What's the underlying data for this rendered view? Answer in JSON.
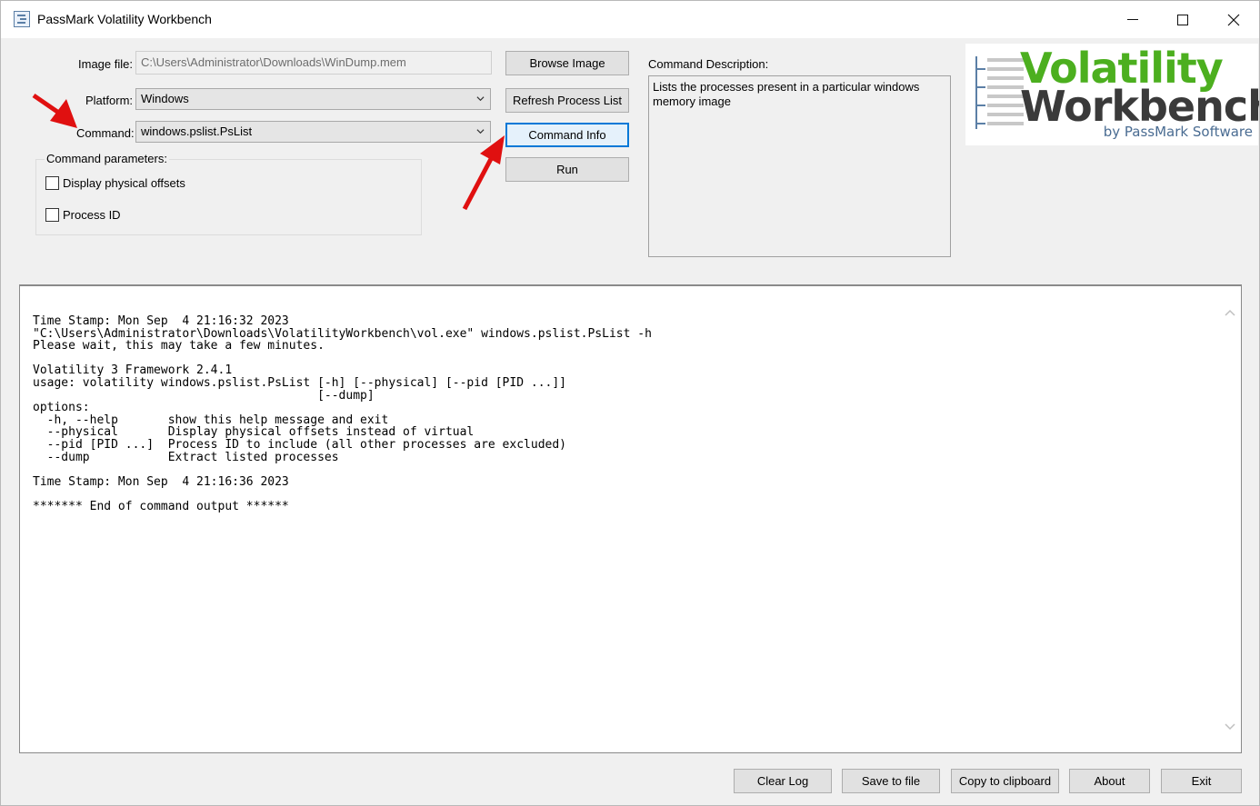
{
  "window": {
    "title": "PassMark Volatility Workbench"
  },
  "form": {
    "image_file_label": "Image file:",
    "image_file_value": "C:\\Users\\Administrator\\Downloads\\WinDump.mem",
    "platform_label": "Platform:",
    "platform_value": "Windows",
    "command_label": "Command:",
    "command_value": "windows.pslist.PsList",
    "params_label": "Command parameters:",
    "params": [
      {
        "label": "Display physical offsets",
        "checked": false
      },
      {
        "label": "Process ID",
        "checked": false
      }
    ]
  },
  "buttons": {
    "browse_image": "Browse Image",
    "refresh_process_list": "Refresh Process List",
    "command_info": "Command Info",
    "run": "Run"
  },
  "description": {
    "label": "Command Description:",
    "text": "Lists the processes present in a particular windows memory image"
  },
  "logo": {
    "word1": "Volatility",
    "word2": "Workbench",
    "byline": "by PassMark Software"
  },
  "log": {
    "lines": [
      "Time Stamp: Mon Sep  4 21:16:32 2023",
      "\"C:\\Users\\Administrator\\Downloads\\VolatilityWorkbench\\vol.exe\" windows.pslist.PsList -h",
      "Please wait, this may take a few minutes.",
      "",
      "Volatility 3 Framework 2.4.1",
      "usage: volatility windows.pslist.PsList [-h] [--physical] [--pid [PID ...]]",
      "                                        [--dump]",
      "options:",
      "  -h, --help       show this help message and exit",
      "  --physical       Display physical offsets instead of virtual",
      "  --pid [PID ...]  Process ID to include (all other processes are excluded)",
      "  --dump           Extract listed processes",
      "",
      "Time Stamp: Mon Sep  4 21:16:36 2023",
      "",
      "******* End of command output ******"
    ]
  },
  "footer": {
    "clear_log": "Clear Log",
    "save_to_file": "Save to file",
    "copy_to_clipboard": "Copy to clipboard",
    "about": "About",
    "exit": "Exit"
  },
  "colors": {
    "accent": "#0078d7",
    "annotation_arrow": "#e01010",
    "logo_green": "#4caf1f",
    "logo_dark": "#3a3a3a"
  }
}
